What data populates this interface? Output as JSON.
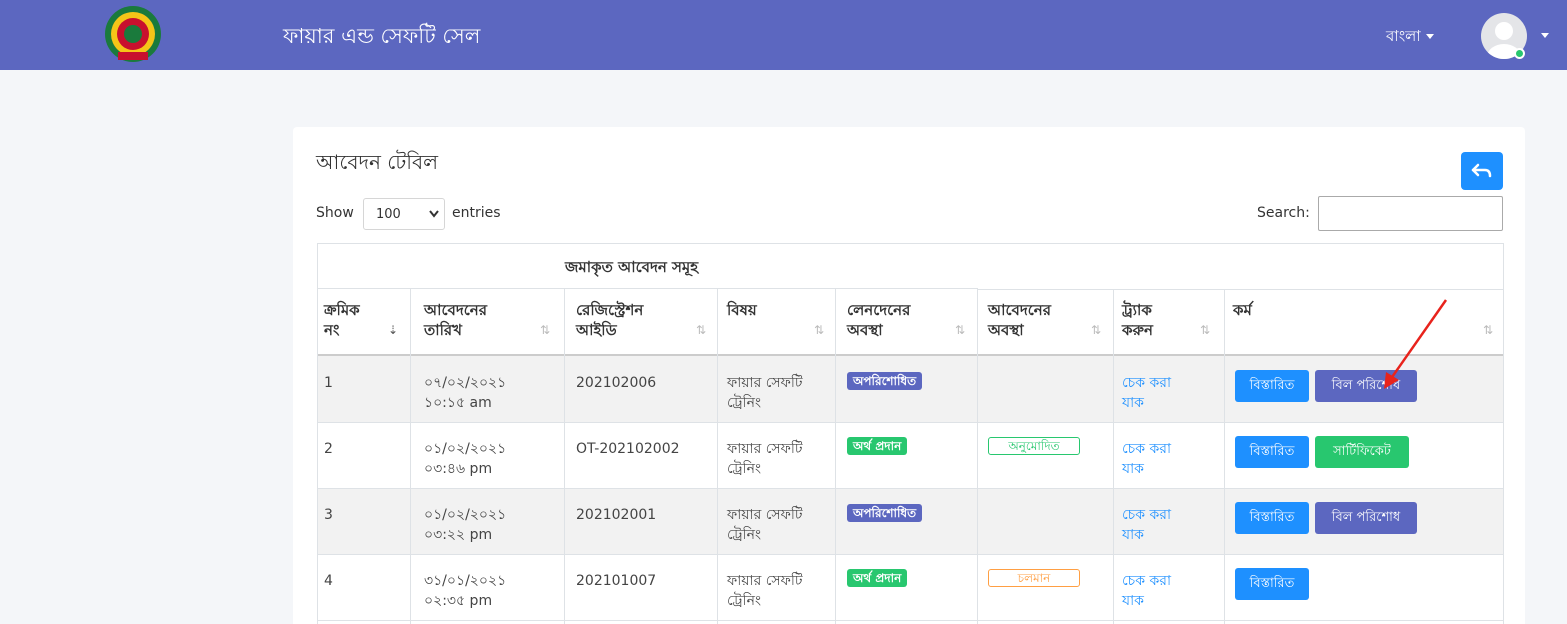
{
  "header": {
    "brand": "ফায়ার এন্ড সেফটি সেল",
    "language": "বাংলা"
  },
  "card": {
    "title": "আবেদন টেবিল",
    "show_label": "Show",
    "entries_value": "100",
    "entries_label": "entries",
    "search_label": "Search:",
    "search_value": ""
  },
  "table": {
    "group_header": "জমাকৃত আবেদন সমূহ",
    "headers": [
      {
        "line1": "ক্রমিক",
        "line2": "নং"
      },
      {
        "line1": "আবেদনের",
        "line2": "তারিখ"
      },
      {
        "line1": "রেজিস্ট্রেশন",
        "line2": "আইডি"
      },
      {
        "line1": "",
        "line2": "বিষয়"
      },
      {
        "line1": "লেনদেনের",
        "line2": "অবস্থা"
      },
      {
        "line1": "আবেদনের",
        "line2": "অবস্থা"
      },
      {
        "line1": "ট্র্যাক",
        "line2": "করুন"
      },
      {
        "line1": "",
        "line2": "কর্ম"
      }
    ],
    "rows": [
      {
        "sl": "1",
        "date": "০৭/০২/২০২১",
        "time": "১০:১৫ am",
        "reg_id": "202102006",
        "subject1": "ফায়ার সেফটি",
        "subject2": "ট্রেনিং",
        "payment": "অপরিশোধিত",
        "status": "",
        "track1": "চেক করা",
        "track2": "যাক",
        "btn1": "বিস্তারিত",
        "btn2": "বিল পরিশোধ"
      },
      {
        "sl": "2",
        "date": "০১/০২/২০২১",
        "time": "০৩:৪৬ pm",
        "reg_id": "OT-202102002",
        "subject1": "ফায়ার সেফটি",
        "subject2": "ট্রেনিং",
        "payment": "অর্থ প্রদান",
        "status": "অনুমোদিত",
        "track1": "চেক করা",
        "track2": "যাক",
        "btn1": "বিস্তারিত",
        "btn2": "সার্টিফিকেট"
      },
      {
        "sl": "3",
        "date": "০১/০২/২০২১",
        "time": "০৩:২২ pm",
        "reg_id": "202102001",
        "subject1": "ফায়ার সেফটি",
        "subject2": "ট্রেনিং",
        "payment": "অপরিশোধিত",
        "status": "",
        "track1": "চেক করা",
        "track2": "যাক",
        "btn1": "বিস্তারিত",
        "btn2": "বিল পরিশোধ"
      },
      {
        "sl": "4",
        "date": "৩১/০১/২০২১",
        "time": "০২:৩৫ pm",
        "reg_id": "202101007",
        "subject1": "ফায়ার সেফটি",
        "subject2": "ট্রেনিং",
        "payment": "অর্থ প্রদান",
        "status": "চলমান",
        "track1": "চেক করা",
        "track2": "যাক",
        "btn1": "বিস্তারিত",
        "btn2": ""
      }
    ]
  },
  "colors": {
    "navbar": "#5c67c0",
    "info_button": "#1e90ff",
    "success": "#28c76f",
    "warning": "#ff9f43",
    "annotation_arrow": "#e8231c"
  },
  "icons": [
    "logo-emblem",
    "language-caret-icon",
    "avatar-icon",
    "back-arrow-icon",
    "sort-icon",
    "red-arrow-annotation"
  ]
}
